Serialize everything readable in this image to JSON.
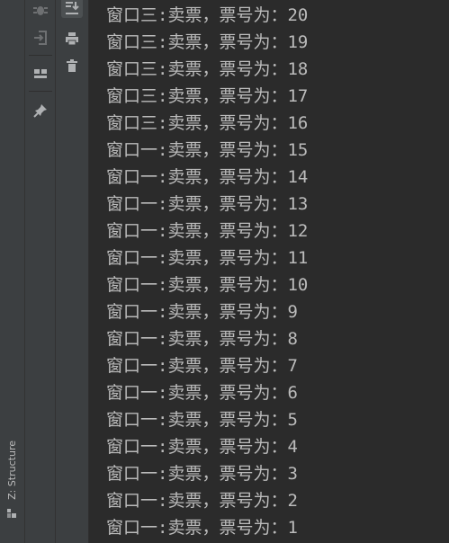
{
  "sidebar": {
    "structure_tab_label": "Z: Structure",
    "structure_tab_icon": "structure-icon"
  },
  "toolbar_left": {
    "buttons": [
      {
        "icon": "debug-icon"
      },
      {
        "icon": "login-icon"
      },
      {
        "icon": "layout-icon"
      },
      {
        "icon": "pin-icon"
      }
    ]
  },
  "toolbar_right": {
    "buttons": [
      {
        "icon": "scroll-to-end-icon",
        "active": true
      },
      {
        "icon": "print-icon"
      },
      {
        "icon": "trash-icon"
      }
    ]
  },
  "console": {
    "lines": [
      "窗口三:卖票，票号为：20",
      "窗口三:卖票，票号为：19",
      "窗口三:卖票，票号为：18",
      "窗口三:卖票，票号为：17",
      "窗口三:卖票，票号为：16",
      "窗口一:卖票，票号为：15",
      "窗口一:卖票，票号为：14",
      "窗口一:卖票，票号为：13",
      "窗口一:卖票，票号为：12",
      "窗口一:卖票，票号为：11",
      "窗口一:卖票，票号为：10",
      "窗口一:卖票，票号为：9",
      "窗口一:卖票，票号为：8",
      "窗口一:卖票，票号为：7",
      "窗口一:卖票，票号为：6",
      "窗口一:卖票，票号为：5",
      "窗口一:卖票，票号为：4",
      "窗口一:卖票，票号为：3",
      "窗口一:卖票，票号为：2",
      "窗口一:卖票，票号为：1"
    ]
  },
  "colors": {
    "console_bg": "#2b2b2b",
    "panel_bg": "#3c3f41",
    "text": "#bbbbbb",
    "icon": "#afb1b3"
  }
}
